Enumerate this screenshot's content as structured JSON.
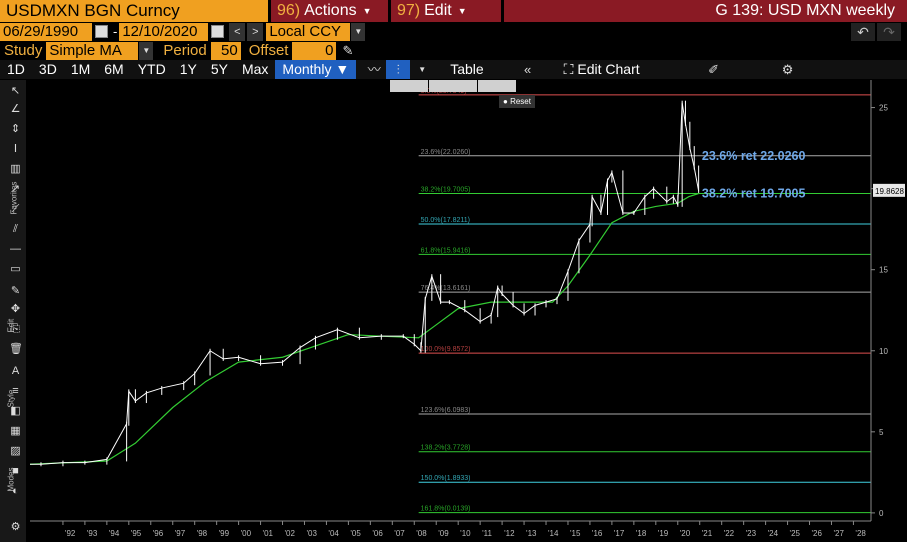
{
  "header": {
    "ticker": "USDMXN BGN Curncy",
    "actions_num": "96)",
    "actions_label": "Actions",
    "edit_num": "97)",
    "edit_label": "Edit",
    "graph_title": "G 139: USD MXN weekly"
  },
  "range": {
    "start_date": "06/29/1990",
    "separator": "-",
    "end_date": "12/10/2020",
    "currency": "Local CCY"
  },
  "study": {
    "label": "Study",
    "value": "Simple MA",
    "period_label": "Period",
    "period_value": "50",
    "offset_label": "Offset",
    "offset_value": "0"
  },
  "periods": [
    "1D",
    "3D",
    "1M",
    "6M",
    "YTD",
    "1Y",
    "5Y",
    "Max"
  ],
  "frequency": "Monthly",
  "toolbar": {
    "table_label": "Table",
    "edit_chart_label": "Edit Chart"
  },
  "side_labels": {
    "favorites": "Favorites",
    "edit": "Edit",
    "style": "Style",
    "modes": "Modes"
  },
  "mini_buttons": [
    "Reset"
  ],
  "colors": {
    "background": "#000000",
    "price": "#ffffff",
    "moving_average": "#33cc33",
    "accent": "#f0a020",
    "menu": "#8a1a24",
    "fib_annotation": "#6fa8e8"
  },
  "chart_data": {
    "type": "line",
    "series": [
      {
        "kind": "ohlc-bars",
        "x": [
          1990.5,
          1991.0,
          1992.0,
          1993.0,
          1994.0,
          1994.9,
          1995.0,
          1995.3,
          1995.8,
          1996.5,
          1997.5,
          1998.0,
          1998.7,
          1999.3,
          2000.0,
          2001.0,
          2002.0,
          2002.8,
          2003.5,
          2004.5,
          2005.5,
          2006.5,
          2007.5,
          2008.0,
          2008.3,
          2008.5,
          2008.8,
          2009.2,
          2009.6,
          2010.3,
          2011.0,
          2011.5,
          2011.8,
          2012.0,
          2012.5,
          2013.0,
          2013.5,
          2014.0,
          2014.5,
          2015.0,
          2015.5,
          2016.0,
          2016.1,
          2016.5,
          2016.8,
          2017.0,
          2017.5,
          2018.0,
          2018.5,
          2018.9,
          2019.5,
          2019.8,
          2020.0,
          2020.2,
          2020.35,
          2020.55,
          2020.75,
          2020.95
        ],
        "values": [
          3.0,
          3.0,
          3.1,
          3.1,
          3.3,
          5.5,
          7.5,
          6.9,
          7.4,
          7.7,
          8.0,
          8.6,
          10.0,
          9.5,
          9.6,
          9.2,
          9.3,
          10.2,
          10.8,
          11.3,
          10.8,
          10.9,
          10.9,
          10.4,
          10.0,
          13.2,
          14.6,
          13.0,
          13.0,
          12.5,
          11.8,
          12.2,
          13.9,
          13.5,
          12.8,
          12.3,
          12.8,
          13.0,
          13.2,
          14.9,
          16.8,
          17.8,
          19.5,
          18.5,
          20.5,
          21.0,
          18.5,
          18.5,
          19.5,
          20.0,
          19.2,
          19.5,
          19.0,
          25.3,
          24.0,
          22.5,
          21.3,
          19.86
        ]
      },
      {
        "kind": "moving-average",
        "x": [
          1990.5,
          1994.0,
          1995.3,
          1997.0,
          1998.5,
          2000.0,
          2002.0,
          2003.5,
          2005.0,
          2006.5,
          2008.2,
          2009.0,
          2010.0,
          2011.5,
          2013.0,
          2014.3,
          2015.0,
          2016.0,
          2017.0,
          2018.0,
          2019.0,
          2020.0,
          2020.5,
          2020.95
        ],
        "values": [
          3.0,
          3.2,
          4.3,
          6.5,
          8.1,
          9.3,
          9.6,
          10.3,
          11.0,
          10.9,
          10.8,
          11.6,
          12.6,
          13.0,
          13.0,
          13.0,
          14.0,
          15.9,
          17.9,
          18.6,
          18.9,
          19.1,
          19.5,
          19.7
        ]
      }
    ],
    "fib_levels": [
      {
        "label": "0.0%(25.7849)",
        "value": 25.7849,
        "color": "#e05050"
      },
      {
        "label": "23.6%(22.0260)",
        "value": 22.026,
        "color": "#aaaaaa"
      },
      {
        "label": "38.2%(19.7005)",
        "value": 19.7005,
        "color": "#33cc33"
      },
      {
        "label": "50.0%(17.8211)",
        "value": 17.8211,
        "color": "#40d0e0"
      },
      {
        "label": "61.8%(15.9416)",
        "value": 15.9416,
        "color": "#33cc33"
      },
      {
        "label": "76.4%(13.6161)",
        "value": 13.6161,
        "color": "#aaaaaa"
      },
      {
        "label": "100.0%(9.8572)",
        "value": 9.8572,
        "color": "#e05050"
      },
      {
        "label": "123.6%(6.0983)",
        "value": 6.0983,
        "color": "#aaaaaa"
      },
      {
        "label": "138.2%(3.7728)",
        "value": 3.7728,
        "color": "#33cc33"
      },
      {
        "label": "150.0%(1.8933)",
        "value": 1.8933,
        "color": "#40d0e0"
      },
      {
        "label": "161.8%(0.0139)",
        "value": 0.0139,
        "color": "#33cc33"
      }
    ],
    "annotations": [
      {
        "text": "23.6% ret 22.0260",
        "value": 22.026
      },
      {
        "text": "38.2% ret 19.7005",
        "value": 19.7005
      }
    ],
    "last_price": "19.8628",
    "x_tick_labels": [
      "'92",
      "'93",
      "'94",
      "'95",
      "'96",
      "'97",
      "'98",
      "'99",
      "'00",
      "'01",
      "'02",
      "'03",
      "'04",
      "'05",
      "'06",
      "'07",
      "'08",
      "'09",
      "'10",
      "'11",
      "'12",
      "'13",
      "'14",
      "'15",
      "'16",
      "'17",
      "'18",
      "'19",
      "'20",
      "'21",
      "'22",
      "'23",
      "'24",
      "'25",
      "'26",
      "'27",
      "'28"
    ],
    "y_ticks": [
      0,
      5,
      10,
      15,
      20,
      25
    ],
    "xlim": [
      1990.5,
      2028.8
    ],
    "ylim": [
      -0.5,
      26.7
    ],
    "grid": false
  }
}
